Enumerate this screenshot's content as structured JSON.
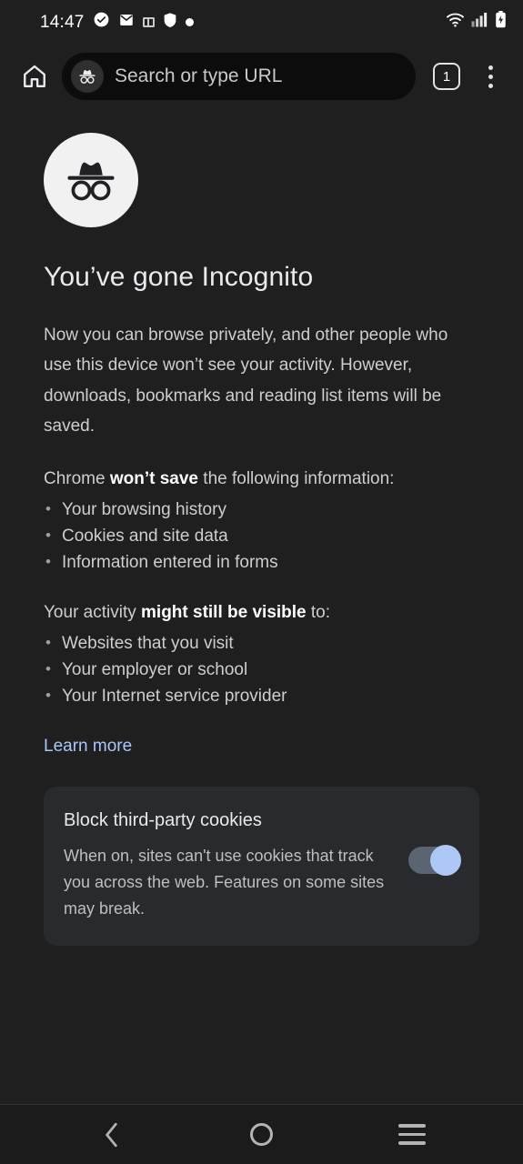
{
  "status_bar": {
    "time": "14:47",
    "left_icons": [
      {
        "name": "check-circle-icon"
      },
      {
        "name": "mail-envelope-icon"
      },
      {
        "name": "app-badge-icon"
      },
      {
        "name": "shield-vpn-icon"
      },
      {
        "name": "notification-dot-icon"
      }
    ],
    "right_icons": [
      {
        "name": "wifi-icon"
      },
      {
        "name": "cellular-signal-icon"
      },
      {
        "name": "battery-charging-icon"
      }
    ]
  },
  "toolbar": {
    "home_label": "Home",
    "omnibox_placeholder": "Search or type URL",
    "omnibox_value": "",
    "tab_count": "1",
    "menu_label": "More options"
  },
  "page": {
    "title": "You’ve gone Incognito",
    "intro": "Now you can browse privately, and other people who use this device won’t see your activity. However, downloads, bookmarks and reading list items will be saved.",
    "wont_save": {
      "prefix": "Chrome ",
      "emphasis": "won’t save",
      "suffix": " the following information:",
      "items": [
        "Your browsing history",
        "Cookies and site data",
        "Information entered in forms"
      ]
    },
    "visible_to": {
      "prefix": "Your activity ",
      "emphasis": "might still be visible",
      "suffix": " to:",
      "items": [
        "Websites that you visit",
        "Your employer or school",
        "Your Internet service provider"
      ]
    },
    "learn_more": "Learn more"
  },
  "cookie_card": {
    "title": "Block third-party cookies",
    "description": "When on, sites can't use cookies that track you across the web. Features on some sites may break.",
    "toggle_state": "on"
  },
  "nav_bar": {
    "back_label": "Back",
    "home_label": "Home",
    "recents_label": "Recent apps"
  },
  "colors": {
    "page_background": "#1f1f1f",
    "card_background": "#292a2d",
    "omnibox_background": "#0c0c0c",
    "link_accent": "#a8c7fa",
    "toggle_thumb": "#aec8f5",
    "toggle_track": "#5b6472",
    "primary_text": "#e8eaed",
    "secondary_text": "#cdced1"
  }
}
